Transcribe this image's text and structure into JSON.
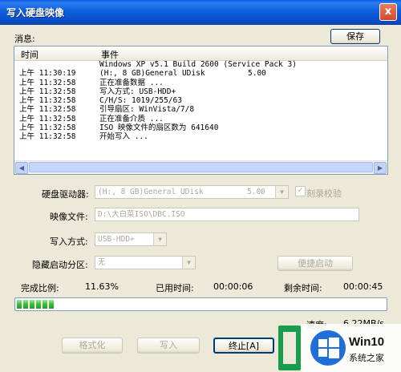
{
  "window": {
    "title": "写入硬盘映像",
    "close_label": "x"
  },
  "log": {
    "section_label": "消息:",
    "save_label": "保存",
    "col_time": "时间",
    "col_event": "事件",
    "rows": [
      {
        "time": "",
        "event": "Windows XP v5.1 Build 2600 (Service Pack 3)",
        "value": ""
      },
      {
        "time": "上午 11:30:19",
        "event": "(H:, 8 GB)General UDisk",
        "value": "5.00"
      },
      {
        "time": "上午 11:32:58",
        "event": "正在准备数据 ...",
        "value": ""
      },
      {
        "time": "上午 11:32:58",
        "event": "写入方式: USB-HDD+",
        "value": ""
      },
      {
        "time": "上午 11:32:58",
        "event": "C/H/S: 1019/255/63",
        "value": ""
      },
      {
        "time": "上午 11:32:58",
        "event": "引导扇区: WinVista/7/8",
        "value": ""
      },
      {
        "time": "上午 11:32:58",
        "event": "正在准备介质 ...",
        "value": ""
      },
      {
        "time": "上午 11:32:58",
        "event": "ISO 映像文件的扇区数为 641640",
        "value": ""
      },
      {
        "time": "上午 11:32:58",
        "event": "开始写入 ...",
        "value": ""
      }
    ]
  },
  "form": {
    "drive_label": "硬盘驱动器:",
    "drive_value": "(H:, 8 GB)General UDisk",
    "drive_version": "5.00",
    "verify_label": "刻录校验",
    "verify_checked": true,
    "image_label": "映像文件:",
    "image_value": "D:\\大白菜ISO\\DBC.ISO",
    "write_mode_label": "写入方式:",
    "write_mode_value": "USB-HDD+",
    "hidden_part_label": "隐藏启动分区:",
    "hidden_part_value": "无",
    "convenient_boot_label": "便捷启动"
  },
  "status": {
    "progress_label": "完成比例:",
    "progress_value": "11.63%",
    "progress_fraction": 0.1163,
    "elapsed_label": "已用时间:",
    "elapsed_value": "00:00:06",
    "remaining_label": "剩余时间:",
    "remaining_value": "00:00:45",
    "speed_label": "速度:",
    "speed_value": "6.22MB/s"
  },
  "buttons": {
    "format_label": "格式化",
    "write_label": "写入",
    "stop_label": "终止[A]"
  },
  "watermark": {
    "line1": "Win10",
    "line2": "系统之家"
  },
  "colors": {
    "title_bar": "#0a5ae6",
    "progress_green": "#32c032",
    "window_bg": "#ece9d8"
  },
  "icons": {
    "close": "close-icon",
    "dropdown": "chevron-down-icon",
    "checkbox": "checkmark-icon"
  }
}
